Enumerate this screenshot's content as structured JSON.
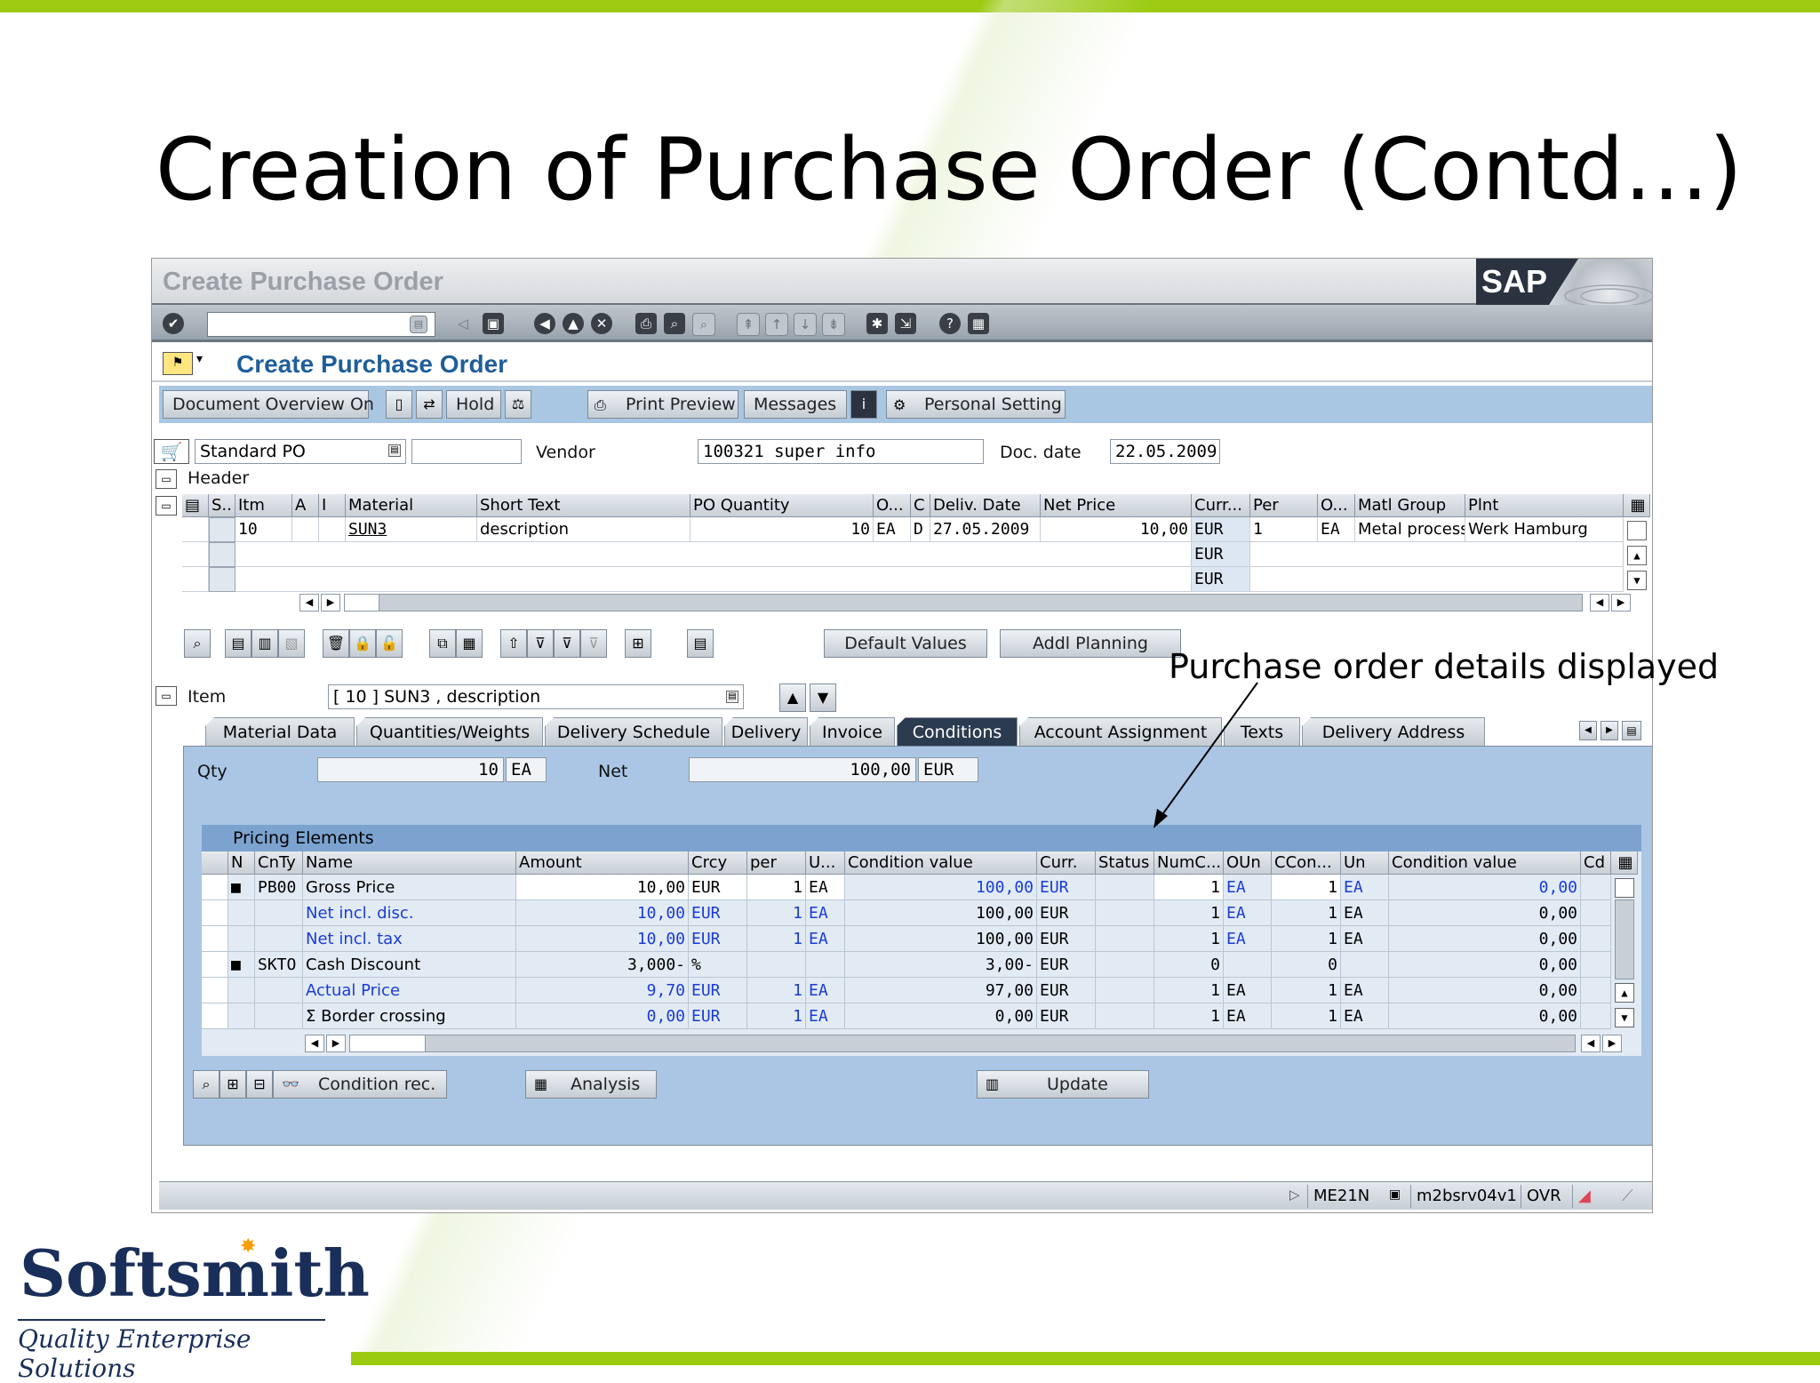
{
  "slide": {
    "title": "Creation of Purchase Order (Contd…)",
    "annotation": "Purchase order details displayed",
    "logo": {
      "name": "Softsmith",
      "tagline": "Quality Enterprise Solutions"
    },
    "colors": {
      "accent_green": "#9ccb11",
      "sap_blue": "#1f5e9a"
    }
  },
  "window": {
    "title": "Create Purchase Order",
    "logo_text": "SAP",
    "screen_title": "Create Purchase Order"
  },
  "app_toolbar": {
    "doc_overview": "Document Overview On",
    "hold": "Hold",
    "print_preview": "Print Preview",
    "messages": "Messages",
    "personal_setting": "Personal Setting"
  },
  "header": {
    "doc_type": "Standard PO",
    "vendor_label": "Vendor",
    "vendor_value": "100321 super info",
    "doc_date_label": "Doc. date",
    "doc_date_value": "22.05.2009",
    "header_label": "Header"
  },
  "item_grid": {
    "columns": [
      "S..",
      "Itm",
      "A",
      "I",
      "Material",
      "Short Text",
      "PO Quantity",
      "O...",
      "C",
      "Deliv. Date",
      "Net Price",
      "Curr...",
      "Per",
      "O...",
      "Matl Group",
      "Plnt"
    ],
    "row1": {
      "itm": "10",
      "material": "SUN3",
      "short_text": "description",
      "qty": "10",
      "oun": "EA",
      "cat": "D",
      "deliv_date": "27.05.2009",
      "net_price": "10,00",
      "curr": "EUR",
      "per": "1",
      "opu": "EA",
      "matl_group": "Metal process",
      "plant": "Werk Hamburg"
    },
    "row2": {
      "curr": "EUR"
    },
    "row3": {
      "curr": "EUR"
    }
  },
  "item_toolbar": {
    "default_values": "Default Values",
    "addl_planning": "Addl Planning"
  },
  "item_detail": {
    "item_label": "Item",
    "item_value": "[ 10 ] SUN3 , description",
    "tabs": [
      "Material Data",
      "Quantities/Weights",
      "Delivery Schedule",
      "Delivery",
      "Invoice",
      "Conditions",
      "Account Assignment",
      "Texts",
      "Delivery Address"
    ],
    "active_tab": "Conditions",
    "qty_label": "Qty",
    "qty_value": "10",
    "qty_unit": "EA",
    "net_label": "Net",
    "net_value": "100,00",
    "net_curr": "EUR"
  },
  "pricing": {
    "title": "Pricing Elements",
    "columns": [
      "N",
      "CnTy",
      "Name",
      "Amount",
      "Crcy",
      "per",
      "U...",
      "Condition value",
      "Curr.",
      "Status",
      "NumC...",
      "OUn",
      "CCon...",
      "Un",
      "Condition value",
      "Cd"
    ],
    "rows": [
      {
        "cnty": "PB00",
        "name": "Gross Price",
        "amount": "10,00",
        "crcy": "EUR",
        "per": "1",
        "uom": "EA",
        "cond_value": "100,00",
        "curr": "EUR",
        "numc": "1",
        "oun": "EA",
        "ccon": "1",
        "un": "EA",
        "cond_value2": "0,00"
      },
      {
        "cnty": "",
        "name": "Net incl. disc.",
        "amount": "10,00",
        "crcy": "EUR",
        "per": "1",
        "uom": "EA",
        "cond_value": "100,00",
        "curr": "EUR",
        "numc": "1",
        "oun": "EA",
        "ccon": "1",
        "un": "EA",
        "cond_value2": "0,00"
      },
      {
        "cnty": "",
        "name": "Net incl. tax",
        "amount": "10,00",
        "crcy": "EUR",
        "per": "1",
        "uom": "EA",
        "cond_value": "100,00",
        "curr": "EUR",
        "numc": "1",
        "oun": "EA",
        "ccon": "1",
        "un": "EA",
        "cond_value2": "0,00"
      },
      {
        "cnty": "SKTO",
        "name": "Cash Discount",
        "amount": "3,000-",
        "crcy": "%",
        "per": "",
        "uom": "",
        "cond_value": "3,00-",
        "curr": "EUR",
        "numc": "0",
        "oun": "",
        "ccon": "0",
        "un": "",
        "cond_value2": "0,00"
      },
      {
        "cnty": "",
        "name": "Actual Price",
        "amount": "9,70",
        "crcy": "EUR",
        "per": "1",
        "uom": "EA",
        "cond_value": "97,00",
        "curr": "EUR",
        "numc": "1",
        "oun": "EA",
        "ccon": "1",
        "un": "EA",
        "cond_value2": "0,00"
      },
      {
        "cnty": "",
        "name": "Border crossing",
        "amount": "0,00",
        "crcy": "EUR",
        "per": "1",
        "uom": "EA",
        "cond_value": "0,00",
        "curr": "EUR",
        "numc": "1",
        "oun": "EA",
        "ccon": "1",
        "un": "EA",
        "cond_value2": "0,00"
      }
    ],
    "condition_rec": "Condition rec.",
    "analysis": "Analysis",
    "update": "Update"
  },
  "statusbar": {
    "transaction": "ME21N",
    "server": "m2bsrv04v1",
    "mode": "OVR"
  }
}
